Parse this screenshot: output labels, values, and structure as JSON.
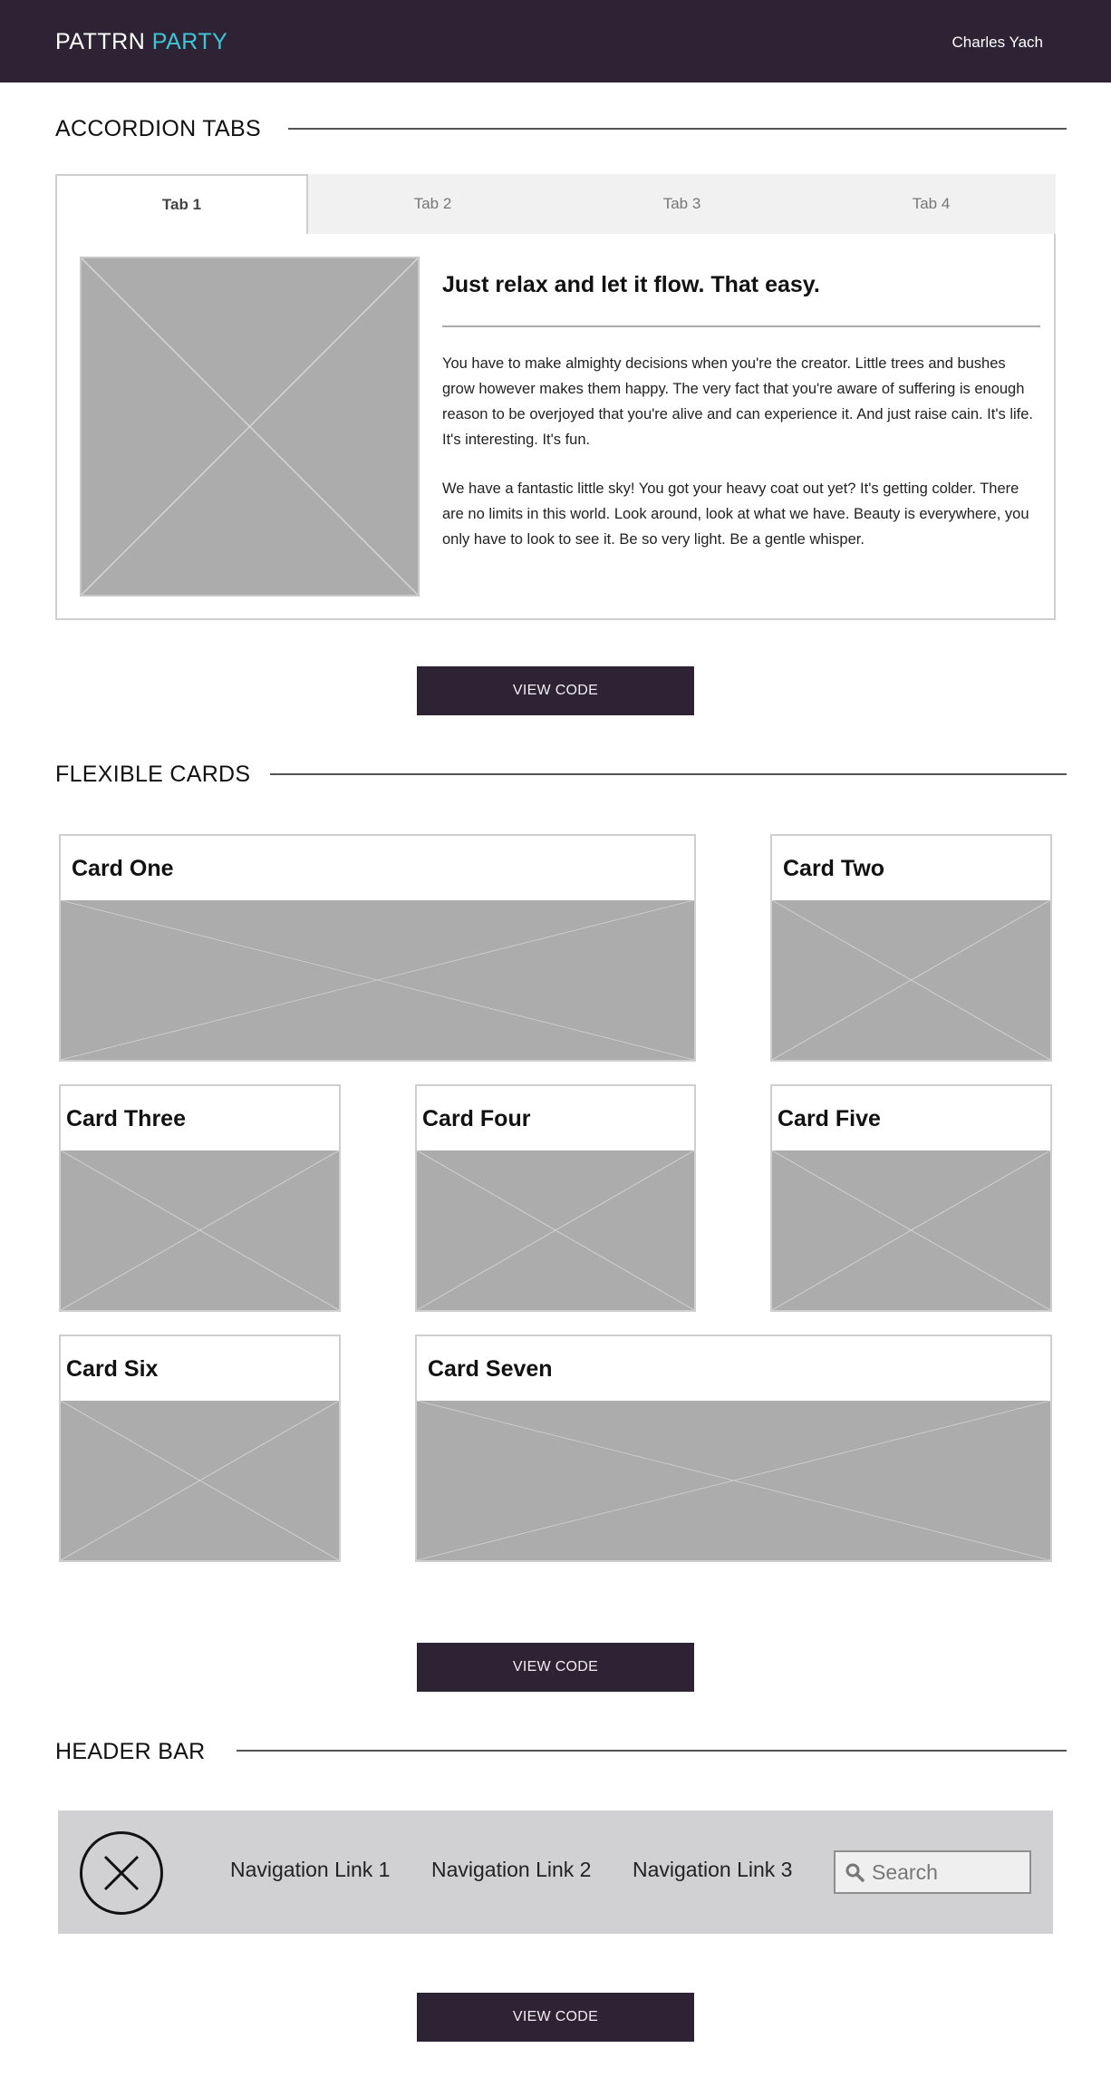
{
  "header": {
    "brand_primary": "PATTRN",
    "brand_accent": "PARTY",
    "user_name": "Charles Yach"
  },
  "colors": {
    "brand_dark": "#2e2335",
    "brand_accent": "#3fc6d4",
    "placeholder_gray": "#acacac"
  },
  "accordion_tabs": {
    "section_title": "ACCORDION TABS",
    "tabs": [
      {
        "label": "Tab 1",
        "active": true
      },
      {
        "label": "Tab 2",
        "active": false
      },
      {
        "label": "Tab 3",
        "active": false
      },
      {
        "label": "Tab 4",
        "active": false
      }
    ],
    "content": {
      "heading": "Just relax and let it flow. That easy.",
      "paragraphs": [
        "You have to make almighty decisions when you're the creator. Little trees and bushes grow however makes them happy. The very fact that you're aware of suffering is enough reason to be overjoyed that you're alive and can experience it. And just raise cain. It's life. It's interesting. It's fun.",
        "We have a fantastic little sky! You got your heavy coat out yet? It's getting colder. There are no limits in this world. Look around, look at what we have. Beauty is everywhere, you only have to look to see it. Be so very light. Be a gentle whisper."
      ]
    },
    "view_code_label": "VIEW CODE"
  },
  "flexible_cards": {
    "section_title": "FLEXIBLE CARDS",
    "cards": [
      {
        "title": "Card One"
      },
      {
        "title": "Card Two"
      },
      {
        "title": "Card Three"
      },
      {
        "title": "Card Four"
      },
      {
        "title": "Card Five"
      },
      {
        "title": "Card Six"
      },
      {
        "title": "Card Seven"
      }
    ],
    "view_code_label": "VIEW CODE"
  },
  "header_bar": {
    "section_title": "HEADER BAR",
    "links": [
      "Navigation Link 1",
      "Navigation Link 2",
      "Navigation Link 3"
    ],
    "search_placeholder": "Search",
    "view_code_label": "VIEW CODE"
  }
}
